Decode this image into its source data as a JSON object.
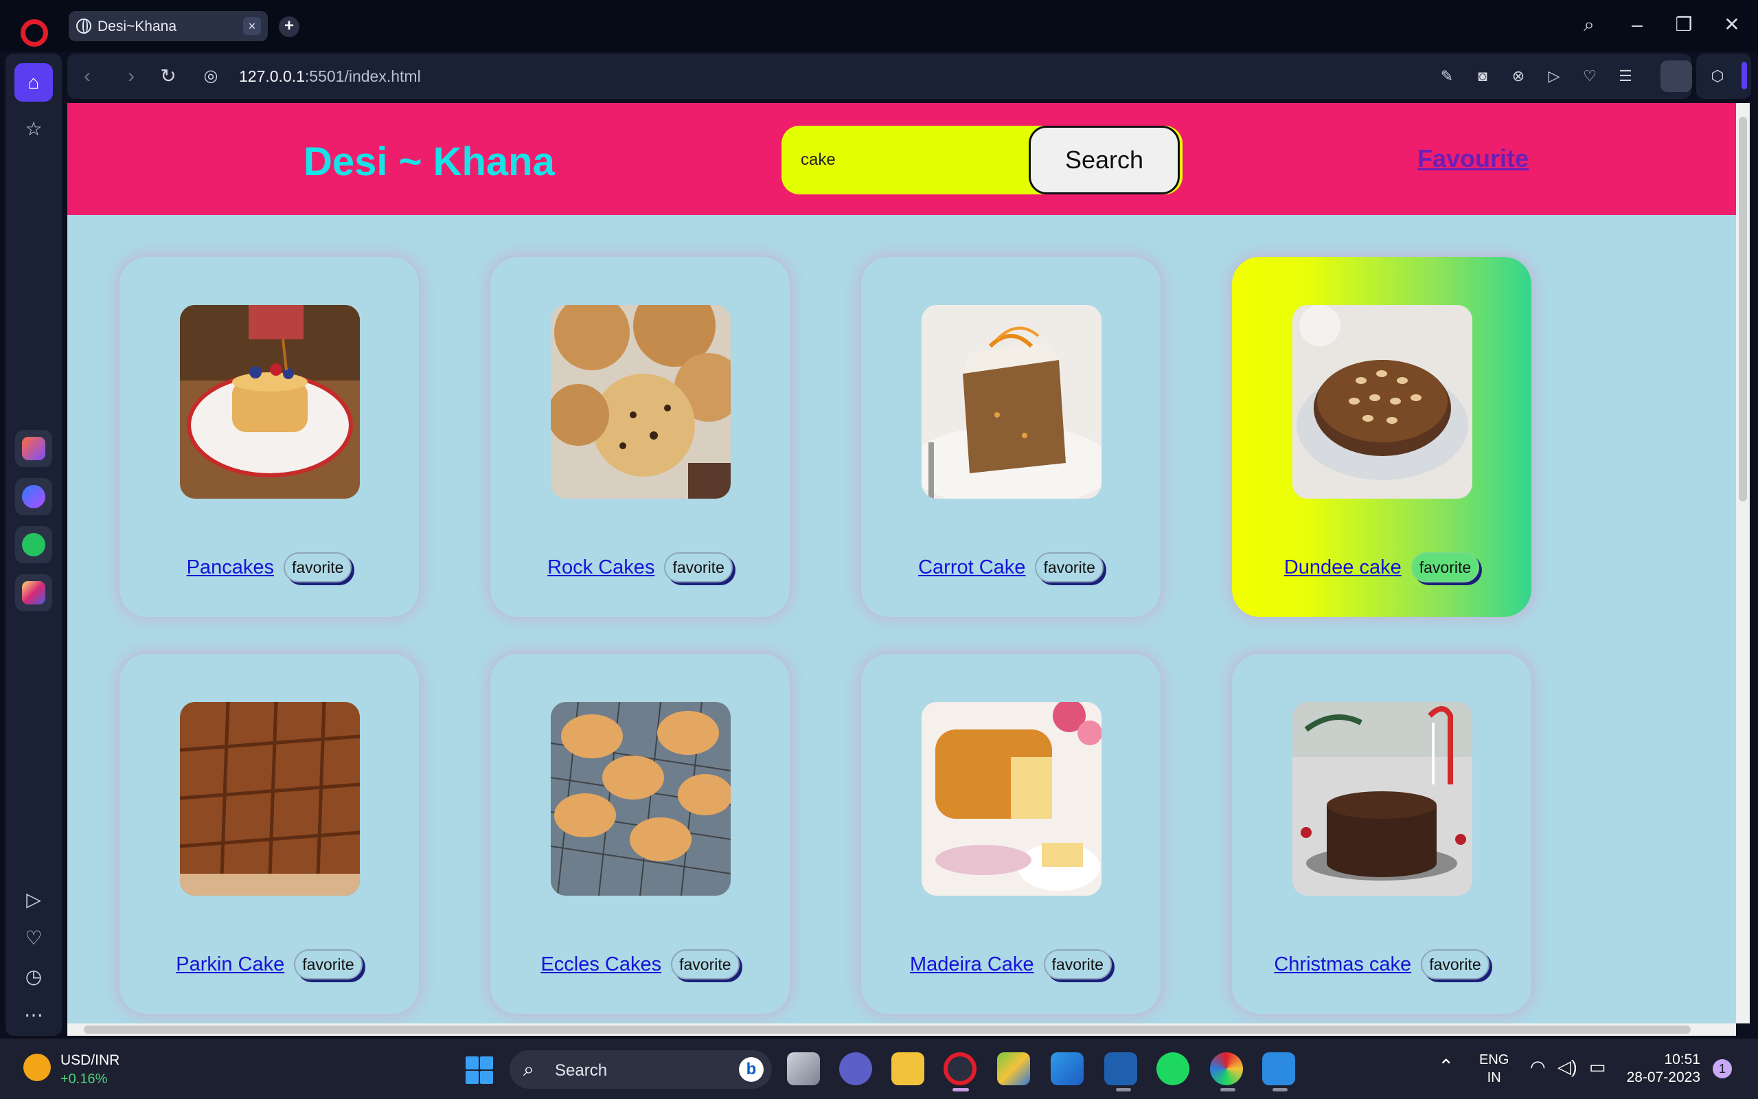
{
  "browser": {
    "tab_title": "Desi~Khana",
    "tab_close": "×",
    "new_tab": "+",
    "url_host": "127.0.0.1",
    "url_rest": ":5501/index.html"
  },
  "site": {
    "title": "Desi ~ Khana",
    "search_value": "cake",
    "search_button": "Search",
    "favourite_link": "Favourite",
    "favorite_button": "favorite"
  },
  "meals": [
    {
      "name": "Pancakes",
      "image": "pancakes-photo"
    },
    {
      "name": "Rock Cakes",
      "image": "rock-cakes-photo"
    },
    {
      "name": "Carrot Cake",
      "image": "carrot-cake-photo"
    },
    {
      "name": "Dundee cake",
      "image": "dundee-cake-photo"
    },
    {
      "name": "Parkin Cake",
      "image": "parkin-cake-photo"
    },
    {
      "name": "Eccles Cakes",
      "image": "eccles-cakes-photo"
    },
    {
      "name": "Madeira Cake",
      "image": "madeira-cake-photo"
    },
    {
      "name": "Christmas cake",
      "image": "christmas-cake-photo"
    }
  ],
  "taskbar": {
    "ticker_name": "USD/INR",
    "ticker_change": "+0.16%",
    "search_label": "Search",
    "lang_line1": "ENG",
    "lang_line2": "IN",
    "time": "10:51",
    "date": "28-07-2023",
    "notifications": "1"
  },
  "colors": {
    "header": "#ee1e6d",
    "page_bg": "#add8e6",
    "title": "#18e2e8",
    "search_bg": "#e4ff00",
    "link": "#1414d6",
    "favourite_link": "#6b1fb8"
  }
}
